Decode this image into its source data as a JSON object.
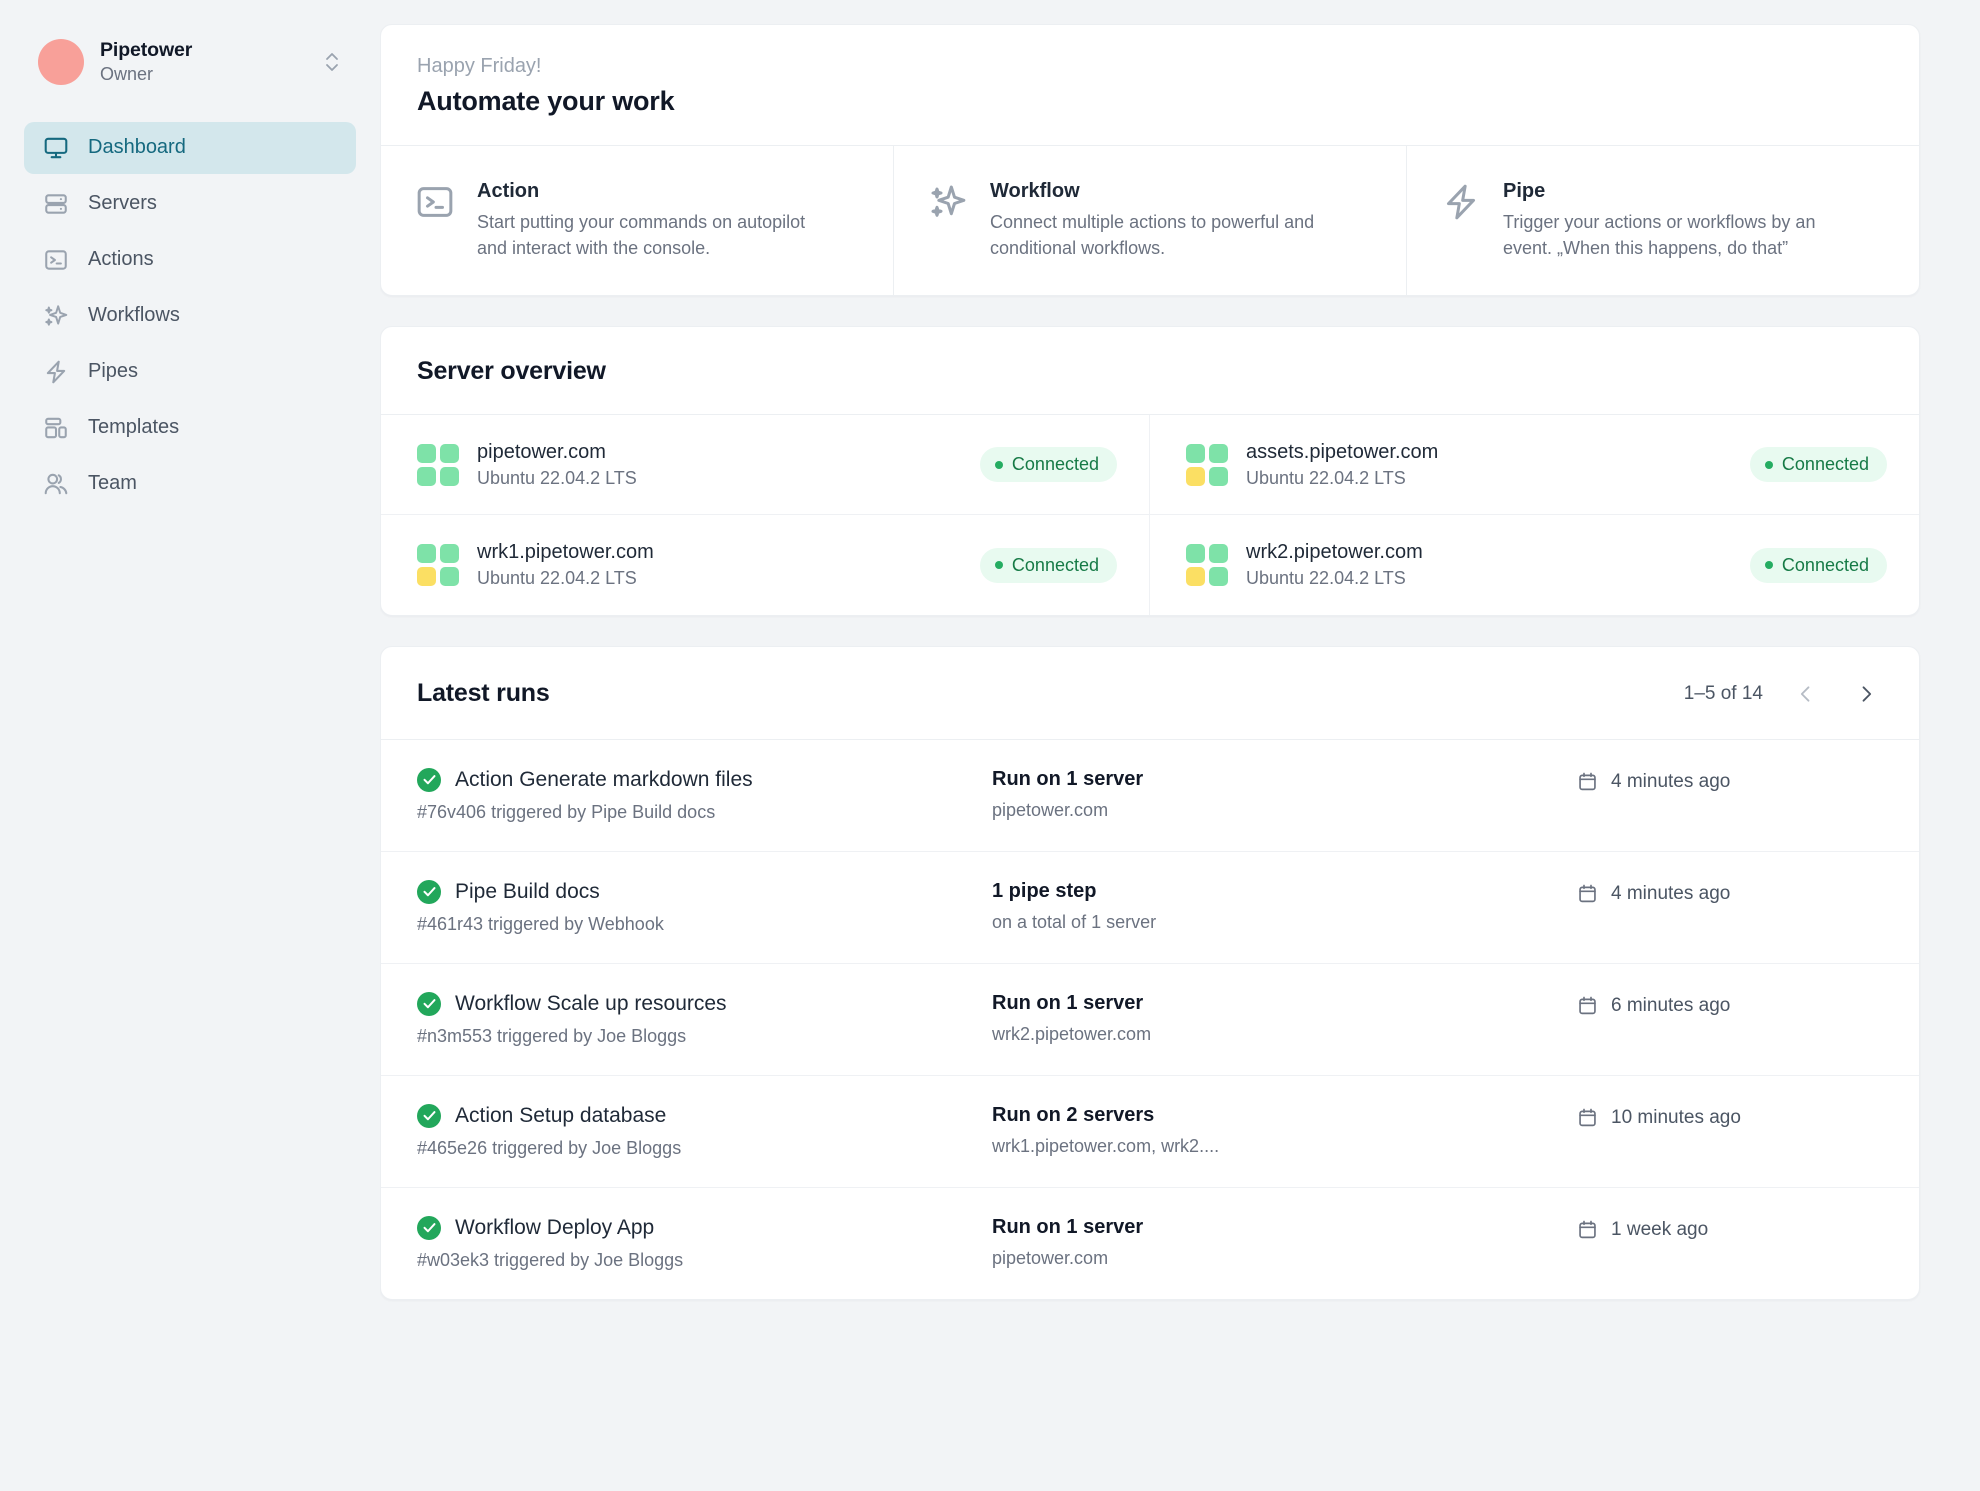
{
  "sidebar": {
    "org": {
      "name": "Pipetower",
      "role": "Owner",
      "avatar_color": "#f8a099",
      "switcher_icon": "chevron-up-down-icon"
    },
    "items": [
      {
        "label": "Dashboard",
        "icon": "monitor-icon",
        "active": true
      },
      {
        "label": "Servers",
        "icon": "server-icon",
        "active": false
      },
      {
        "label": "Actions",
        "icon": "terminal-icon",
        "active": false
      },
      {
        "label": "Workflows",
        "icon": "sparkles-icon",
        "active": false
      },
      {
        "label": "Pipes",
        "icon": "bolt-icon",
        "active": false
      },
      {
        "label": "Templates",
        "icon": "layout-icon",
        "active": false
      },
      {
        "label": "Team",
        "icon": "users-icon",
        "active": false
      }
    ]
  },
  "greeting": {
    "subtitle": "Happy Friday!",
    "title": "Automate your work"
  },
  "features": [
    {
      "icon": "terminal-icon",
      "title": "Action",
      "description": "Start putting your commands on autopilot and interact with the console."
    },
    {
      "icon": "sparkles-icon",
      "title": "Workflow",
      "description": "Connect multiple actions to powerful and conditional workflows."
    },
    {
      "icon": "bolt-icon",
      "title": "Pipe",
      "description": "Trigger your actions or workflows by an event. „When this happens, do that”"
    }
  ],
  "server_overview": {
    "title": "Server overview",
    "servers": [
      {
        "name": "pipetower.com",
        "os": "Ubuntu 22.04.2 LTS",
        "status": "Connected",
        "tiles": [
          "green",
          "green",
          "green",
          "green"
        ]
      },
      {
        "name": "assets.pipetower.com",
        "os": "Ubuntu 22.04.2 LTS",
        "status": "Connected",
        "tiles": [
          "green",
          "green",
          "amber",
          "green"
        ]
      },
      {
        "name": "wrk1.pipetower.com",
        "os": "Ubuntu 22.04.2 LTS",
        "status": "Connected",
        "tiles": [
          "green",
          "green",
          "amber",
          "green"
        ]
      },
      {
        "name": "wrk2.pipetower.com",
        "os": "Ubuntu 22.04.2 LTS",
        "status": "Connected",
        "tiles": [
          "green",
          "green",
          "amber",
          "green"
        ]
      }
    ]
  },
  "latest_runs": {
    "title": "Latest runs",
    "pagination": {
      "label": "1–5 of 14",
      "prev_icon": "chevron-left-icon",
      "next_icon": "chevron-right-icon",
      "prev_enabled": false,
      "next_enabled": true
    },
    "rows": [
      {
        "status": "success",
        "title": "Action Generate markdown files",
        "subtitle": "#76v406 triggered by Pipe Build docs",
        "target_title": "Run on 1 server",
        "target_sub": "pipetower.com",
        "time": "4 minutes ago"
      },
      {
        "status": "success",
        "title": "Pipe Build docs",
        "subtitle": "#461r43 triggered by Webhook",
        "target_title": "1 pipe step",
        "target_sub": "on a total of 1 server",
        "time": "4 minutes ago"
      },
      {
        "status": "success",
        "title": "Workflow Scale up resources",
        "subtitle": "#n3m553 triggered by Joe Bloggs",
        "target_title": "Run on 1 server",
        "target_sub": "wrk2.pipetower.com",
        "time": "6 minutes ago"
      },
      {
        "status": "success",
        "title": "Action Setup database",
        "subtitle": "#465e26 triggered by Joe Bloggs",
        "target_title": "Run on 2 servers",
        "target_sub": "wrk1.pipetower.com, wrk2....",
        "time": "10 minutes ago"
      },
      {
        "status": "success",
        "title": "Workflow Deploy App",
        "subtitle": "#w03ek3 triggered by Joe Bloggs",
        "target_title": "Run on 1 server",
        "target_sub": "pipetower.com",
        "time": "1 week ago"
      }
    ]
  },
  "colors": {
    "accent": "#15697f",
    "accent_bg": "#d3e7ec",
    "success": "#22a75b",
    "badge_bg": "#e8faf0",
    "badge_text": "#167a46",
    "tile_green": "#7ee2a8",
    "tile_amber": "#fbdf63"
  }
}
